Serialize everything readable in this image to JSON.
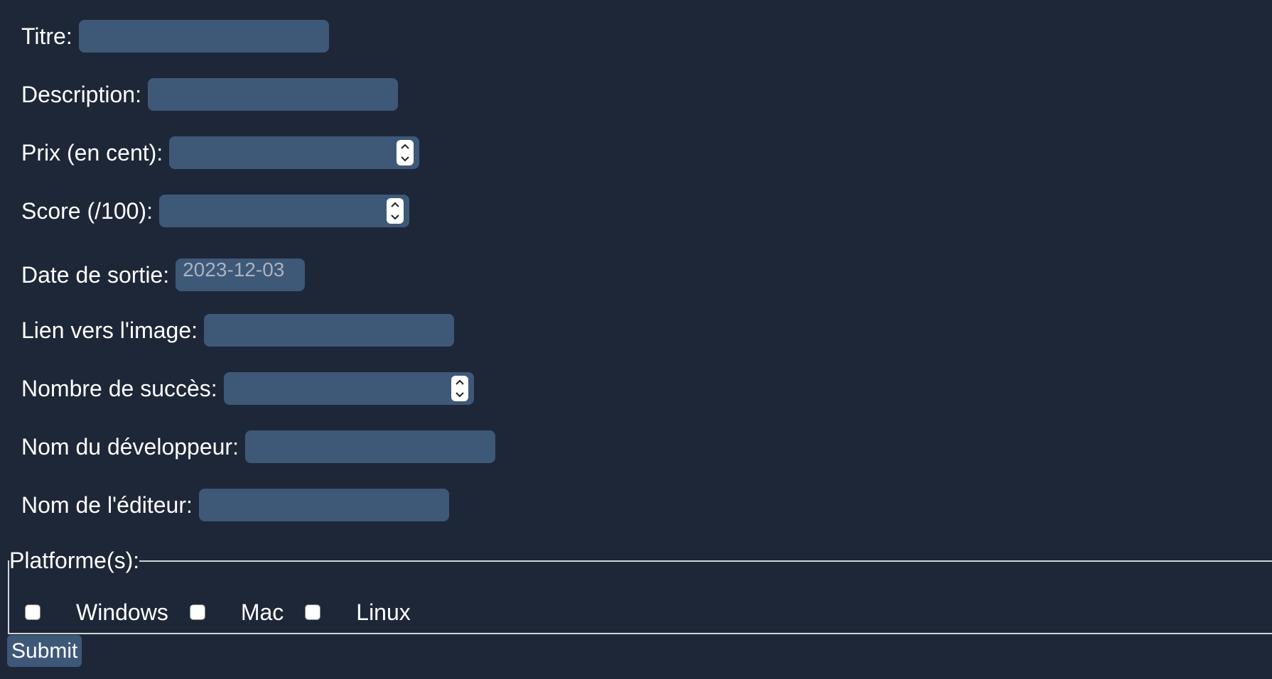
{
  "form": {
    "fields": [
      {
        "label": "Titre:",
        "value": ""
      },
      {
        "label": "Description:",
        "value": ""
      },
      {
        "label": "Prix (en cent):",
        "value": ""
      },
      {
        "label": "Score (/100):",
        "value": ""
      },
      {
        "label": "Date de sortie:",
        "value": "2023-12-03"
      },
      {
        "label": "Lien vers l'image:",
        "value": ""
      },
      {
        "label": "Nombre de succès:",
        "value": ""
      },
      {
        "label": "Nom du développeur:",
        "value": ""
      },
      {
        "label": "Nom de l'éditeur:",
        "value": ""
      }
    ],
    "platforms": {
      "legend": "Platforme(s):",
      "options": [
        {
          "label": "Windows",
          "checked": false
        },
        {
          "label": "Mac",
          "checked": false
        },
        {
          "label": "Linux",
          "checked": false
        }
      ]
    },
    "submit_label": "Submit"
  },
  "colors": {
    "background": "#1e2738",
    "input": "#3e5878",
    "text": "#ffffff",
    "date_text": "#a9b3c1"
  },
  "icons": {
    "spinner_up": "chevron-up-icon",
    "spinner_down": "chevron-down-icon"
  }
}
